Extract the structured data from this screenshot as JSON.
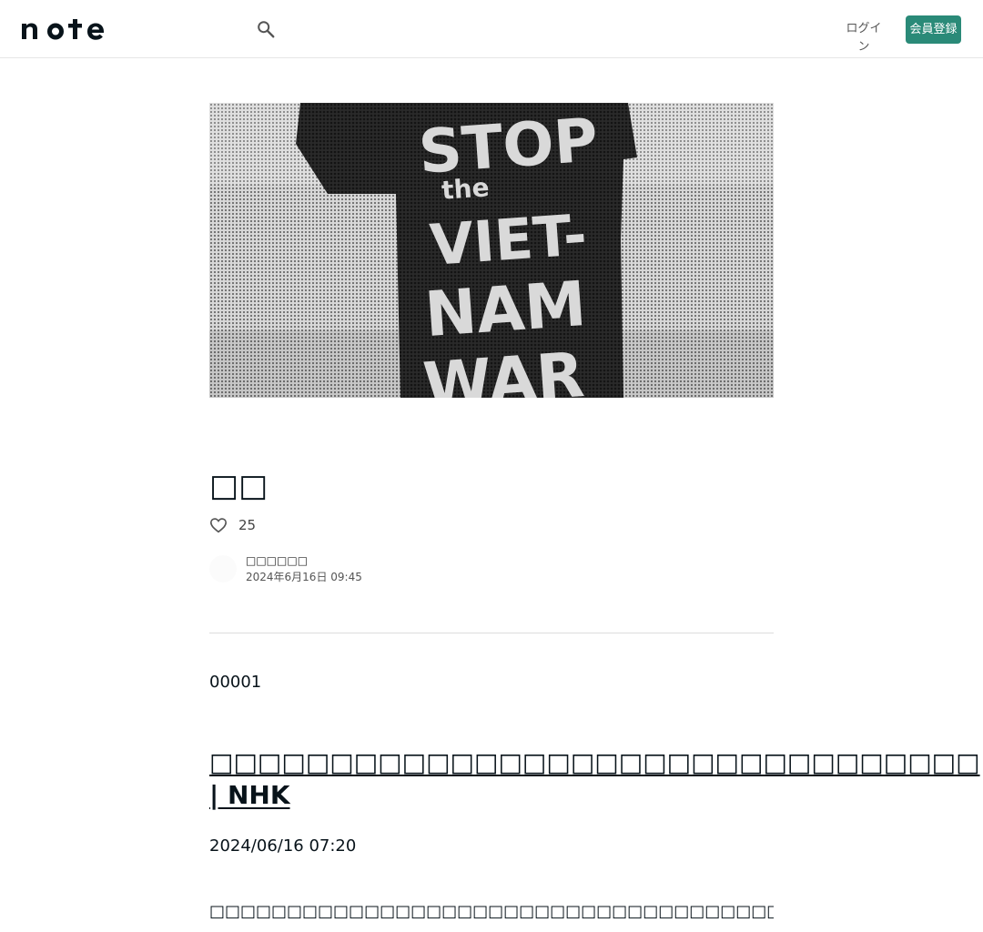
{
  "header": {
    "logo_text": "note",
    "search_icon": "search-icon",
    "login_label": "ログイン",
    "signup_label": "会員登録"
  },
  "hero": {
    "image": "protest-placard-photo",
    "sign_lines": [
      "STOP",
      "the",
      "VIET-",
      "NAM",
      "WAR"
    ]
  },
  "article": {
    "title": "□□",
    "like_icon": "heart-icon",
    "like_count": "25",
    "author_name": "□□□□□□",
    "post_date": "2024年6月16日 09:45",
    "body_id": "00001",
    "link_title": "□□□□□□□□□□□□□□□□□□□□□□□□□□□□□□□□ | NHK",
    "link_date": "2024/06/16 07:20",
    "paragraph": "□□□□□□□□□□□□□□□□□□□□□□□□□□□□□□□□□□□□□□□□□□□□□□□□□□□□□□□□□□□□□□"
  },
  "colors": {
    "accent": "#2a8a78",
    "text": "#08131a",
    "divider": "#dcdcdc"
  }
}
